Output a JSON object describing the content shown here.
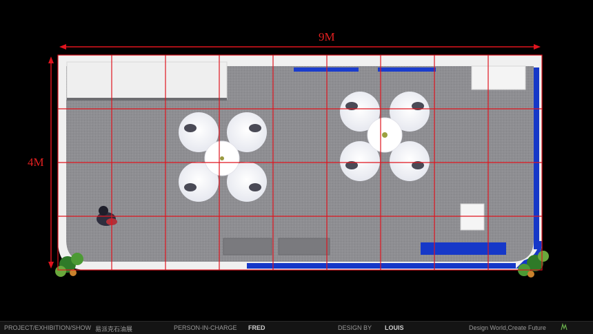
{
  "dimensions": {
    "width_label": "9M",
    "height_label": "4M"
  },
  "footer": {
    "project_label": "PROJECT/EXHIBITION/SHOW",
    "project_value": "易派克石油展",
    "person_label": "PERSON-IN-CHARGE",
    "person_value": "FRED",
    "design_label": "DESIGN BY",
    "design_value": "LOUIS",
    "slogan": "Design World,Create Future"
  },
  "colors": {
    "grid_line": "#e0141e",
    "carpet": "#8c8c90",
    "wall": "#f2f2f2",
    "accent_blue": "#1638c8",
    "background": "#000000"
  },
  "icons": [
    "plant-icon",
    "person-icon",
    "logo-icon"
  ]
}
